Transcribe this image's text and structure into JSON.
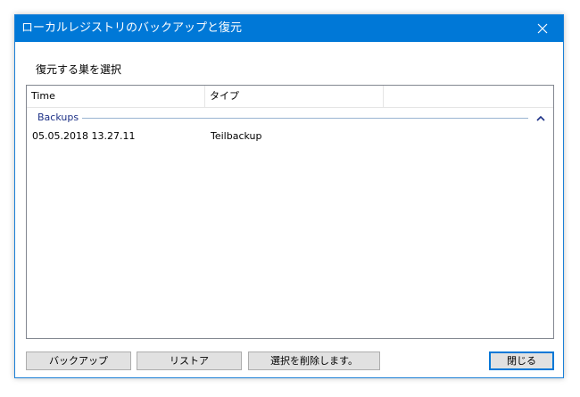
{
  "window": {
    "title": "ローカルレジストリのバックアップと復元",
    "section_label": "復元する巣を選択"
  },
  "listview": {
    "columns": [
      "Time",
      "タイプ",
      ""
    ],
    "group": {
      "name": "Backups"
    },
    "rows": [
      {
        "time": "05.05.2018 13.27.11",
        "type": "Teilbackup"
      }
    ]
  },
  "buttons": {
    "backup": "バックアップ",
    "restore": "リストア",
    "delete": "選択を削除します。",
    "close": "閉じる"
  },
  "colors": {
    "titlebar": "#0078d7",
    "group_text": "#1e3287",
    "button_face": "#e1e1e1"
  },
  "icons": [
    "close-icon",
    "chevron-up-icon"
  ]
}
